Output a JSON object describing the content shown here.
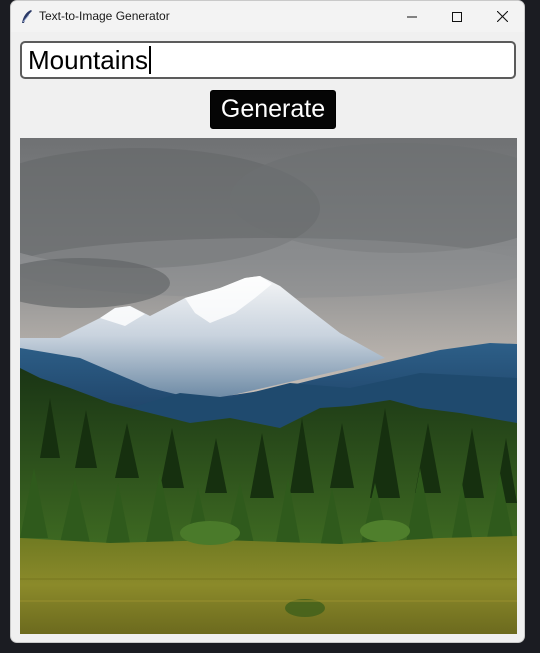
{
  "window": {
    "title": "Text-to-Image Generator",
    "app_icon": "feather-icon",
    "controls": [
      "minimize-icon",
      "maximize-icon",
      "close-icon"
    ]
  },
  "prompt": {
    "value": "Mountains"
  },
  "generate": {
    "label": "Generate"
  },
  "image": {
    "subject": "mountains",
    "colors": {
      "sky": "#9a9c9e",
      "snow": "#f2f3f4",
      "mountain_blue": "#2f5d82",
      "forest": "#234a1c",
      "meadow": "#8a8a2c"
    }
  }
}
